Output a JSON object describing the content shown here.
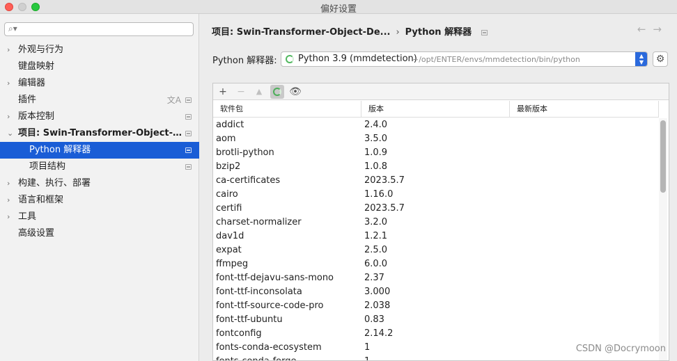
{
  "window": {
    "title": "偏好设置"
  },
  "search": {
    "value": "",
    "placeholder": ""
  },
  "sidebar": {
    "items": [
      {
        "label": "外观与行为"
      },
      {
        "label": "键盘映射"
      },
      {
        "label": "编辑器"
      },
      {
        "label": "插件"
      },
      {
        "label": "版本控制"
      },
      {
        "label": "项目: Swin-Transformer-Object-De..."
      },
      {
        "label": "Python 解释器"
      },
      {
        "label": "项目结构"
      },
      {
        "label": "构建、执行、部署"
      },
      {
        "label": "语言和框架"
      },
      {
        "label": "工具"
      },
      {
        "label": "高级设置"
      }
    ]
  },
  "breadcrumb": {
    "project": "项目: Swin-Transformer-Object-De...",
    "page": "Python 解释器"
  },
  "interpreter": {
    "label": "Python 解释器:",
    "name": "Python 3.9 (mmdetection)",
    "path": "~/opt/ENTER/envs/mmdetection/bin/python"
  },
  "table": {
    "columns": [
      "软件包",
      "版本",
      "最新版本"
    ],
    "rows": [
      [
        "addict",
        "2.4.0",
        ""
      ],
      [
        "aom",
        "3.5.0",
        ""
      ],
      [
        "brotli-python",
        "1.0.9",
        ""
      ],
      [
        "bzip2",
        "1.0.8",
        ""
      ],
      [
        "ca-certificates",
        "2023.5.7",
        ""
      ],
      [
        "cairo",
        "1.16.0",
        ""
      ],
      [
        "certifi",
        "2023.5.7",
        ""
      ],
      [
        "charset-normalizer",
        "3.2.0",
        ""
      ],
      [
        "dav1d",
        "1.2.1",
        ""
      ],
      [
        "expat",
        "2.5.0",
        ""
      ],
      [
        "ffmpeg",
        "6.0.0",
        ""
      ],
      [
        "font-ttf-dejavu-sans-mono",
        "2.37",
        ""
      ],
      [
        "font-ttf-inconsolata",
        "3.000",
        ""
      ],
      [
        "font-ttf-source-code-pro",
        "2.038",
        ""
      ],
      [
        "font-ttf-ubuntu",
        "0.83",
        ""
      ],
      [
        "fontconfig",
        "2.14.2",
        ""
      ],
      [
        "fonts-conda-ecosystem",
        "1",
        ""
      ],
      [
        "fonts-conda-forge",
        "1",
        ""
      ]
    ]
  },
  "watermark": "CSDN @Docrymoon"
}
